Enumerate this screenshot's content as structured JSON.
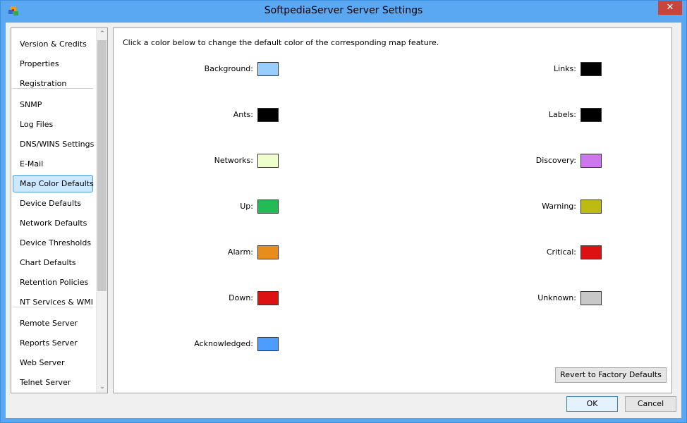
{
  "window": {
    "title": "SoftpediaServer Server Settings",
    "close_glyph": "✕"
  },
  "sidebar": {
    "items": [
      {
        "label": "Version & Credits"
      },
      {
        "label": "Properties"
      },
      {
        "label": "Registration"
      },
      {
        "label": "SNMP"
      },
      {
        "label": "Log Files"
      },
      {
        "label": "DNS/WINS Settings"
      },
      {
        "label": "E-Mail"
      },
      {
        "label": "Map Color Defaults",
        "selected": true
      },
      {
        "label": "Device Defaults"
      },
      {
        "label": "Network Defaults"
      },
      {
        "label": "Device Thresholds"
      },
      {
        "label": "Chart Defaults"
      },
      {
        "label": "Retention Policies"
      },
      {
        "label": "NT Services & WMI"
      },
      {
        "label": "Remote Server"
      },
      {
        "label": "Reports Server"
      },
      {
        "label": "Web Server"
      },
      {
        "label": "Telnet Server"
      }
    ],
    "scroll_up_glyph": "⌃",
    "scroll_down_glyph": "⌄"
  },
  "panel": {
    "instructions": "Click a color below to change the default color of the corresponding map feature.",
    "left_colors": [
      {
        "label": "Background:",
        "color": "#99ccff"
      },
      {
        "label": "Ants:",
        "color": "#000000"
      },
      {
        "label": "Networks:",
        "color": "#eeffcc"
      },
      {
        "label": "Up:",
        "color": "#22bb55"
      },
      {
        "label": "Alarm:",
        "color": "#e88c1c"
      },
      {
        "label": "Down:",
        "color": "#dd1111"
      },
      {
        "label": "Acknowledged:",
        "color": "#4d9cff"
      }
    ],
    "right_colors": [
      {
        "label": "Links:",
        "color": "#000000"
      },
      {
        "label": "Labels:",
        "color": "#000000"
      },
      {
        "label": "Discovery:",
        "color": "#cc77ee"
      },
      {
        "label": "Warning:",
        "color": "#bbbb11"
      },
      {
        "label": "Critical:",
        "color": "#dd1111"
      },
      {
        "label": "Unknown:",
        "color": "#c8c8c8"
      }
    ],
    "revert_label": "Revert to Factory Defaults"
  },
  "footer": {
    "ok_label": "OK",
    "cancel_label": "Cancel"
  }
}
